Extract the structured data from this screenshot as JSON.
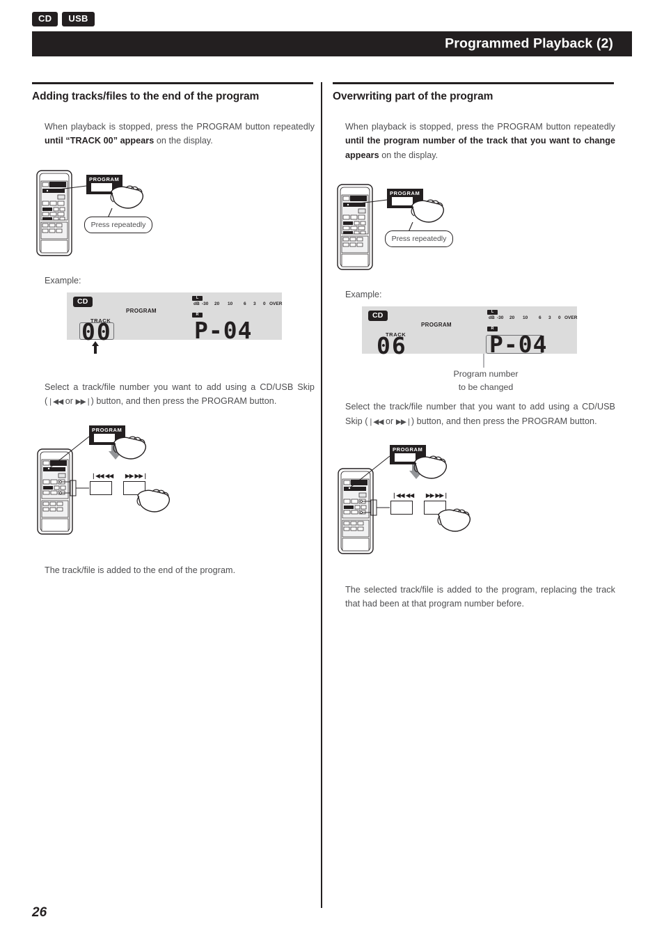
{
  "header": {
    "tags": [
      "CD",
      "USB"
    ],
    "title": "Programmed Playback (2)"
  },
  "columns": {
    "left": {
      "heading": "Adding tracks/files to the end of the program",
      "step1_a": "When playback is stopped, press the PROGRAM button repeatedly ",
      "step1_b": "until “TRACK 00” appears",
      "step1_c": " on the display.",
      "remote_callout": "PROGRAM",
      "balloon": "Press repeatedly",
      "example_label": "Example:",
      "display": {
        "badge": "CD",
        "program_label": "PROGRAM",
        "track_label": "TRACK",
        "track_value": "00",
        "program_value": "P-04",
        "meter_left": "L",
        "meter_right": "R",
        "meter_unit": "dB",
        "meter_ticks": [
          "-30",
          "20",
          "10",
          "6",
          "3",
          "0",
          "OVER"
        ]
      },
      "step2_a": "Select a track/file number you want to add using a CD/USB Skip (",
      "step2_skip1": "❘◀◀",
      "step2_or": " or ",
      "step2_skip2": "▶▶❘",
      "step2_b": ") button, and then press the PROGRAM button.",
      "skip_label_left": "❘◀◀ ◀◀",
      "skip_label_right": "▶▶ ▶▶❘",
      "result": "The track/file is added to the end of the program."
    },
    "right": {
      "heading": "Overwriting part of the program",
      "step1_a": "When playback is stopped, press the PROGRAM button repeatedly ",
      "step1_b": "until the program number of the track that you want to change appears",
      "step1_c": " on the display.",
      "remote_callout": "PROGRAM",
      "balloon": "Press repeatedly",
      "example_label": "Example:",
      "display": {
        "badge": "CD",
        "program_label": "PROGRAM",
        "track_label": "TRACK",
        "track_value": "06",
        "program_value": "P-04",
        "meter_left": "L",
        "meter_right": "R",
        "meter_unit": "dB",
        "meter_ticks": [
          "-30",
          "20",
          "10",
          "6",
          "3",
          "0",
          "OVER"
        ]
      },
      "display_caption_line1": "Program number",
      "display_caption_line2": "to be changed",
      "step2_a": "Select the track/file number that you want to add using a CD/USB Skip (",
      "step2_skip1": "❘◀◀",
      "step2_or": " or ",
      "step2_skip2": "▶▶❘",
      "step2_b": ") button, and then press the PROGRAM button.",
      "skip_label_left": "❘◀◀ ◀◀",
      "skip_label_right": "▶▶ ▶▶❘",
      "result": "The selected track/file is added to the program, replacing the track that had been at that program number before."
    }
  },
  "footer": {
    "page_number": "26"
  },
  "colors": {
    "ink": "#231f20",
    "body_text": "#4d4d4f",
    "display_bg": "#dcdcdc",
    "arrow_gray": "#808285"
  }
}
